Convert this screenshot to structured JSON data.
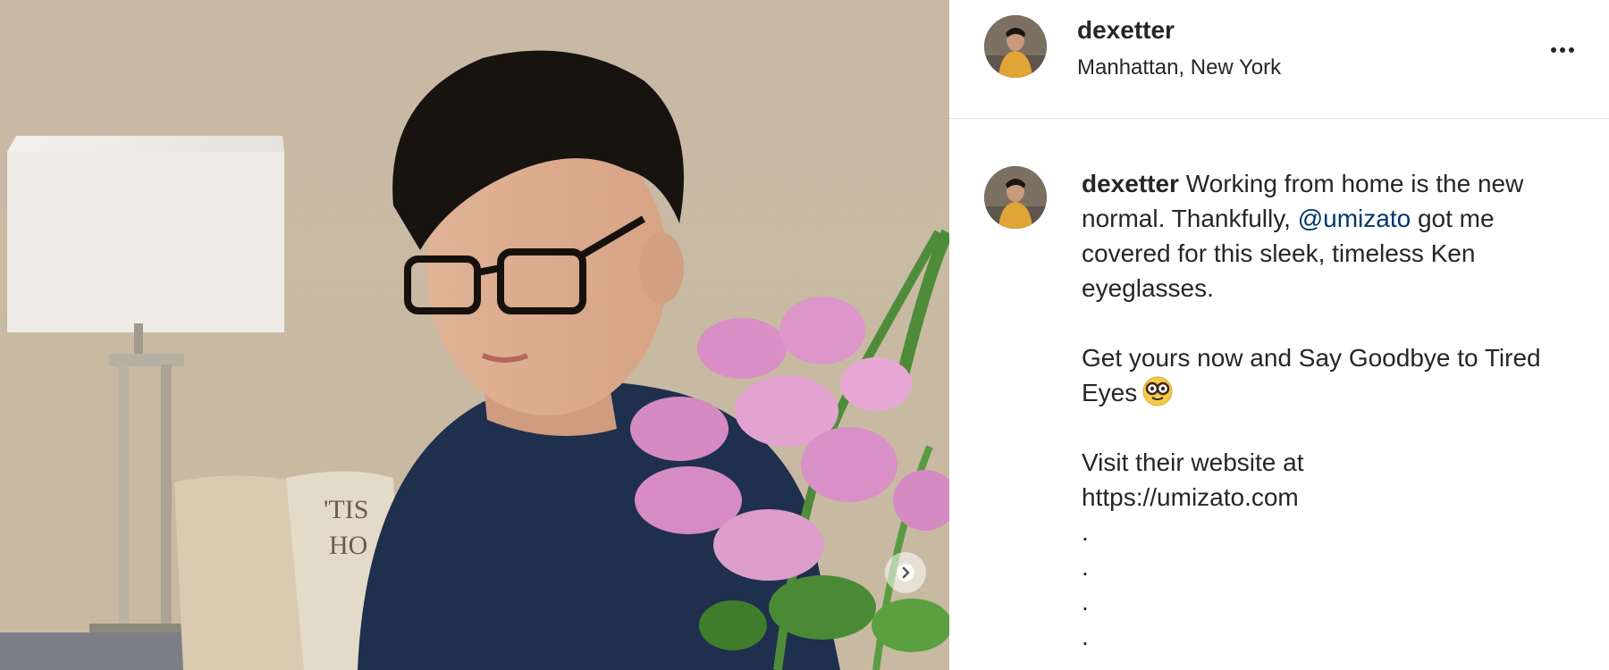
{
  "post": {
    "username": "dexetter",
    "location": "Manhattan, New York",
    "caption": {
      "username": "dexetter",
      "line1_text": " Working from home is the new normal. Thankfully, ",
      "mention": "@umizato",
      "line1_rest": " got me covered for this sleek, timeless Ken eyeglasses.",
      "paragraph2": "Get yours now and Say Goodbye to Tired Eyes",
      "paragraph2_emoji": "nerd-face-emoji",
      "paragraph3_line1": "Visit their website at",
      "paragraph3_line2": "https://umizato.com",
      "dots": [
        ".",
        ".",
        ".",
        "."
      ]
    }
  },
  "icons": {
    "more": "more-options-icon",
    "carousel": "chevron-right-icon"
  },
  "colors": {
    "text": "#262626",
    "mention": "#00376b",
    "divider": "#e4e4e4",
    "sweater": "#1f2f4e",
    "flowers": "#d98ec6"
  }
}
